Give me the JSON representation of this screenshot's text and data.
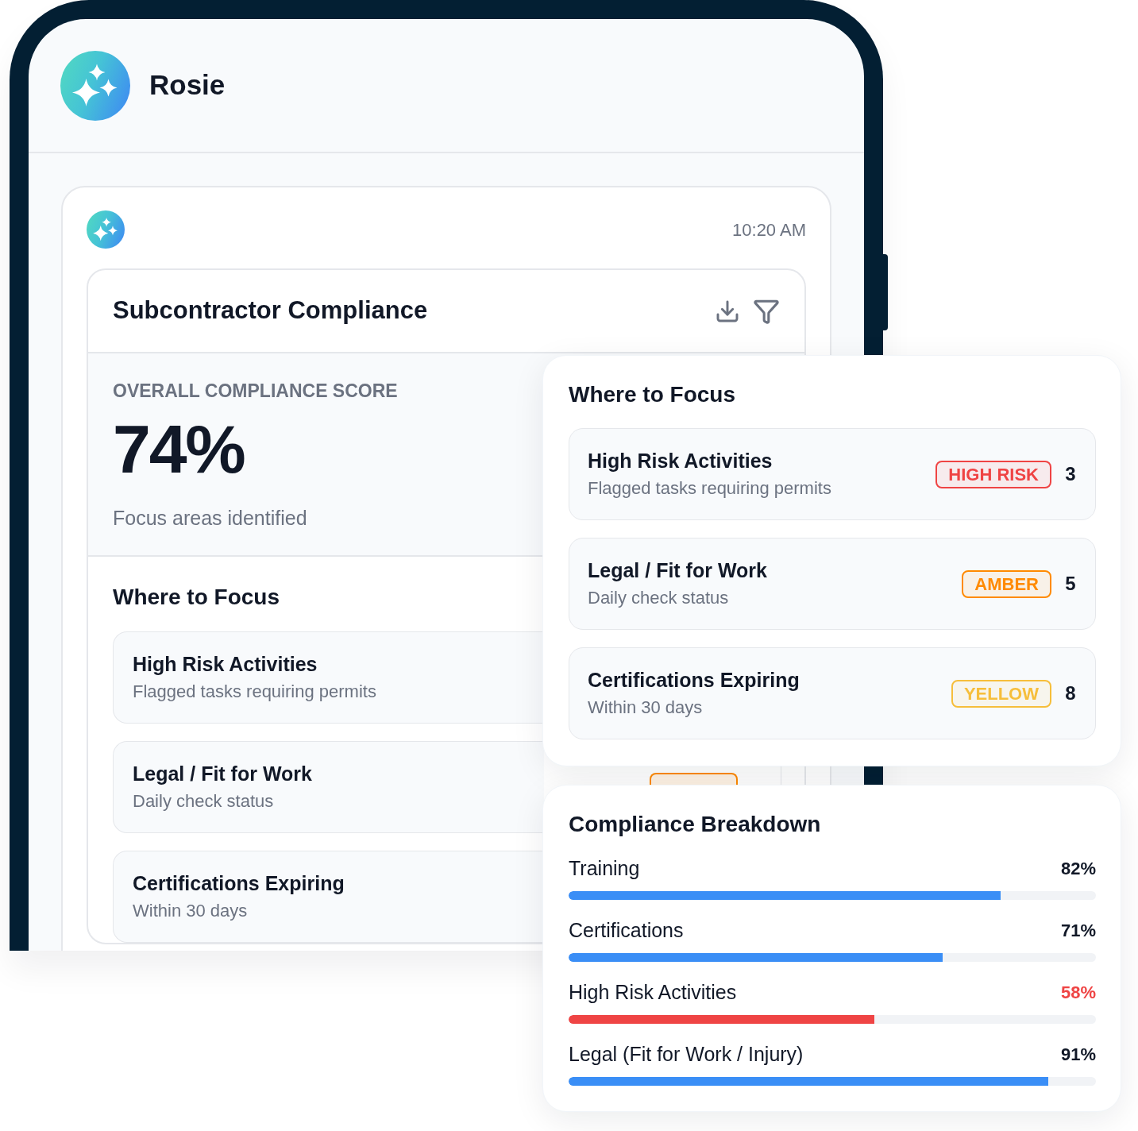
{
  "app": {
    "name": "Rosie"
  },
  "message": {
    "time": "10:20 AM",
    "card": {
      "title": "Subcontractor Compliance",
      "score_label": "OVERALL COMPLIANCE SCORE",
      "score": "74%",
      "score_caption": "Focus areas identified",
      "focus_heading": "Where to Focus",
      "focus_items": [
        {
          "title": "High Risk Activities",
          "subtitle": "Flagged tasks requiring permits"
        },
        {
          "title": "Legal / Fit for Work",
          "subtitle": "Daily check status",
          "color": "#ff8a00"
        },
        {
          "title": "Certifications Expiring",
          "subtitle": "Within 30 days"
        }
      ]
    }
  },
  "focus_panel": {
    "heading": "Where to Focus",
    "items": [
      {
        "title": "High Risk Activities",
        "subtitle": "Flagged tasks requiring permits",
        "badge": "HIGH RISK",
        "color": "#ef4444",
        "count": "3"
      },
      {
        "title": "Legal / Fit for Work",
        "subtitle": "Daily check status",
        "badge": "AMBER",
        "color": "#ff8a00",
        "count": "5"
      },
      {
        "title": "Certifications Expiring",
        "subtitle": "Within 30 days",
        "badge": "YELLOW",
        "color": "#f6be3b",
        "count": "8"
      }
    ]
  },
  "breakdown": {
    "heading": "Compliance Breakdown",
    "items": [
      {
        "label": "Training",
        "value": "82%",
        "level": 0.82,
        "alert": false
      },
      {
        "label": "Certifications",
        "value": "71%",
        "level": 0.71,
        "alert": false
      },
      {
        "label": "High Risk Activities",
        "value": "58%",
        "level": 0.58,
        "alert": true
      },
      {
        "label": "Legal (Fit for Work / Injury)",
        "value": "91%",
        "level": 0.91,
        "alert": false
      }
    ]
  }
}
